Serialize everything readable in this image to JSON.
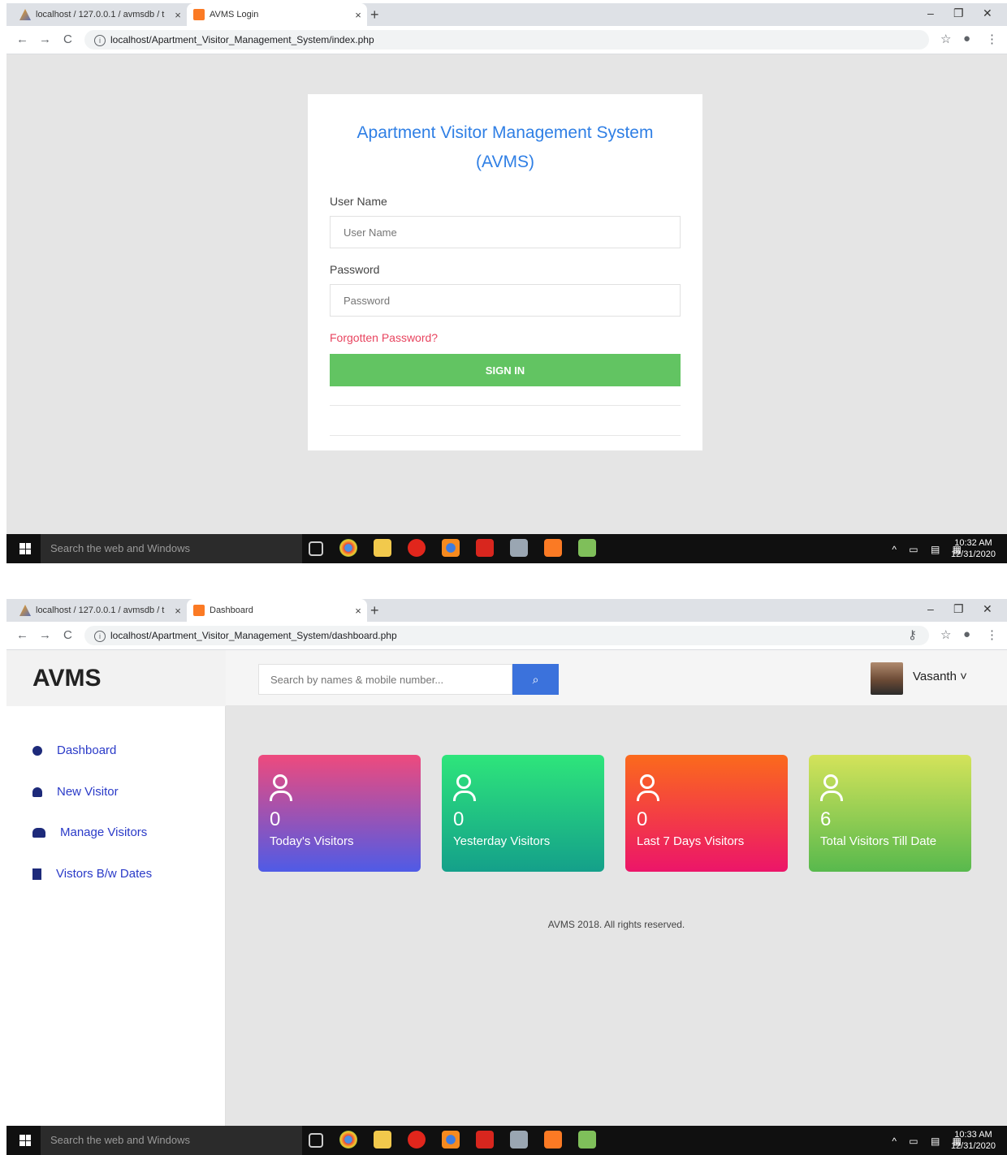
{
  "login_window": {
    "tabs": [
      {
        "title": "localhost / 127.0.0.1 / avmsdb / t",
        "close": "×"
      },
      {
        "title": "AVMS Login",
        "close": "×"
      }
    ],
    "new_tab": "+",
    "window_controls": {
      "minimize": "–",
      "restore": "❐",
      "close": "✕"
    },
    "nav": {
      "back": "←",
      "forward": "→",
      "reload": "C"
    },
    "url": "localhost/Apartment_Visitor_Management_System/index.php",
    "info_glyph": "i",
    "toolbar_glyphs": {
      "star": "☆",
      "profile": "●",
      "menu": "⋮"
    },
    "login": {
      "title": "Apartment Visitor Management System (AVMS)",
      "username_label": "User Name",
      "username_placeholder": "User Name",
      "password_label": "Password",
      "password_placeholder": "Password",
      "forgot": "Forgotten Password?",
      "signin": "SIGN IN"
    },
    "taskbar": {
      "search": "Search the web and Windows",
      "time": "10:32 AM",
      "date": "12/31/2020"
    }
  },
  "dashboard_window": {
    "tabs": [
      {
        "title": "localhost / 127.0.0.1 / avmsdb / t",
        "close": "×"
      },
      {
        "title": "Dashboard",
        "close": "×"
      }
    ],
    "new_tab": "+",
    "window_controls": {
      "minimize": "–",
      "restore": "❐",
      "close": "✕"
    },
    "nav": {
      "back": "←",
      "forward": "→",
      "reload": "C"
    },
    "url": "localhost/Apartment_Visitor_Management_System/dashboard.php",
    "info_glyph": "i",
    "toolbar_glyphs": {
      "key": "⚷",
      "star": "☆",
      "profile": "●",
      "menu": "⋮"
    },
    "brand": "AVMS",
    "search_placeholder": "Search by names & mobile number...",
    "search_glyph": "⌕",
    "user": "Vasanth ˅",
    "sidebar": [
      {
        "label": "Dashboard"
      },
      {
        "label": "New Visitor"
      },
      {
        "label": "Manage Visitors"
      },
      {
        "label": "Vistors B/w Dates"
      }
    ],
    "cards": [
      {
        "count": "0",
        "label": "Today's Visitors"
      },
      {
        "count": "0",
        "label": "Yesterday Visitors"
      },
      {
        "count": "0",
        "label": "Last 7 Days Visitors"
      },
      {
        "count": "6",
        "label": "Total Visitors Till Date"
      }
    ],
    "footer": "AVMS 2018. All rights reserved.",
    "taskbar": {
      "search": "Search the web and Windows",
      "time": "10:33 AM",
      "date": "12/31/2020"
    }
  },
  "colors": {
    "title_blue": "#2f7fe5",
    "signin_green": "#62c462",
    "forgot_red": "#e8445f",
    "card_gradients": [
      "#ee4a7d→#4f5be6",
      "#2ee57b→#14a08a",
      "#fb6a1c→#ec1569",
      "#d4e35a→#58b94d"
    ]
  }
}
